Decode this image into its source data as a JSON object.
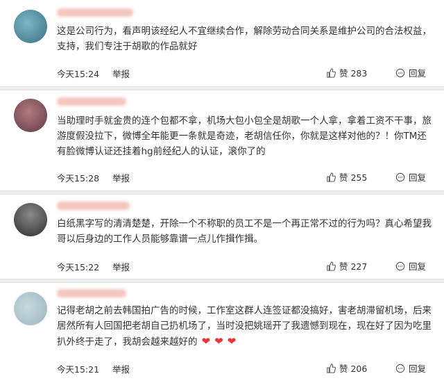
{
  "comments": [
    {
      "text": "这是公司行为，看声明该经纪人不宜继续合作，解除劳动合同关系是维护公司的合法权益，支持，我们专注于胡歌的作品就好",
      "time": "今天15:24",
      "report": "举报",
      "likes": "赞 283",
      "reply": "回复",
      "avatar_colors": [
        "#7ab7c8",
        "#3d6f80"
      ]
    },
    {
      "text": "当助理时手就金贵的连个包都不拿，机场大包小包全是胡歌一个人拿，拿着工资不干事，旅游度假没拉下，微博全年能更一条就是奇迹，老胡信任你，你就是这样对他的？！你TM还有脸微博认证还挂着hg前经纪人的认证，滚你了的",
      "time": "今天15:28",
      "report": "举报",
      "likes": "赞 255",
      "reply": "回复",
      "avatar_colors": [
        "#b47a7e",
        "#5d3b45"
      ]
    },
    {
      "text": "白纸黑字写的清清楚楚，开除一个不称职的员工不是一个再正常不过的行为吗？真心希望我哥以后身边的工作人员能够靠谱一点儿作揖作揖。",
      "time": "今天15:22",
      "report": "举报",
      "likes": "赞 227",
      "reply": "回复",
      "avatar_colors": [
        "#8a8a8a",
        "#2e2e2e"
      ]
    },
    {
      "text": "记得老胡之前去韩国拍广告的时候，工作室这群人连签证都没搞好，害老胡滞留机场，后来居然所有人回国把老胡自己扔机场了，当时没把姚瑶开了我遗憾到现在，现在好了因为吃里扒外终于走了，我胡会越来越好的",
      "hearts": [
        "❤",
        "❤",
        "❤"
      ],
      "time": "今天15:21",
      "report": "举报",
      "likes": "赞 206",
      "reply": "回复",
      "avatar_colors": [
        "#9ab6c0",
        "#c8d8de"
      ]
    }
  ],
  "icons": {
    "like": "thumbs-up-icon",
    "reply": "comment-bubble-icon"
  },
  "colors": {
    "heart": "#e8363a",
    "name_blur": "#f3c6bd",
    "separator": "#eeeeee"
  }
}
